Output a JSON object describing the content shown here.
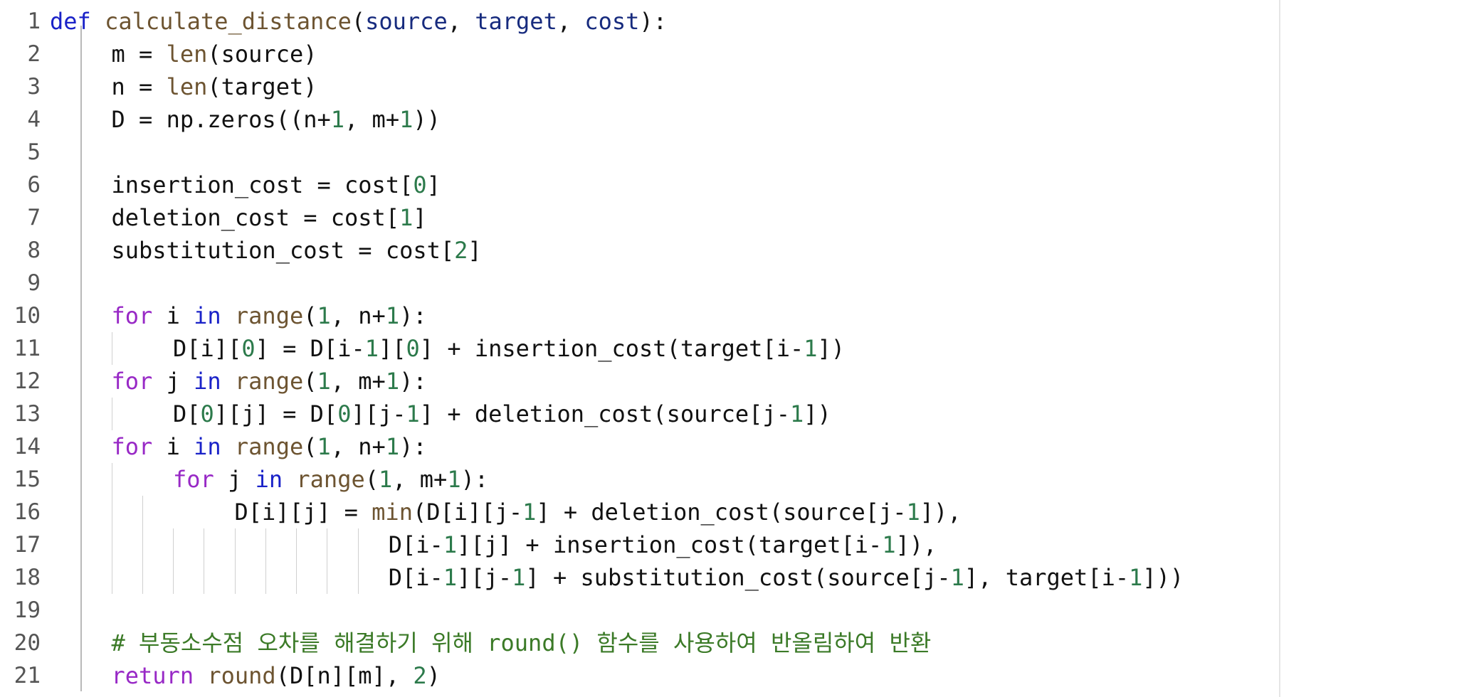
{
  "editor": {
    "language": "python",
    "colors": {
      "background": "#ffffff",
      "line_number": "#555555",
      "def_keyword": "#1a22c8",
      "function_name": "#6d5431",
      "parameter": "#172b7e",
      "control_keyword": "#9829c6",
      "operator_keyword": "#1a22c8",
      "number": "#2c7a4b",
      "builtin": "#6d5431",
      "comment": "#3b7a27",
      "text": "#111111"
    },
    "lines": [
      {
        "n": "1",
        "indent": 0,
        "tokens": [
          [
            "def",
            "def"
          ],
          [
            "plain",
            " "
          ],
          [
            "fn",
            "calculate_distance"
          ],
          [
            "plain",
            "("
          ],
          [
            "param",
            "source"
          ],
          [
            "plain",
            ", "
          ],
          [
            "param",
            "target"
          ],
          [
            "plain",
            ", "
          ],
          [
            "param",
            "cost"
          ],
          [
            "plain",
            "):"
          ]
        ]
      },
      {
        "n": "2",
        "indent": 1,
        "tokens": [
          [
            "plain",
            "m = "
          ],
          [
            "builtin",
            "len"
          ],
          [
            "plain",
            "(source)"
          ]
        ]
      },
      {
        "n": "3",
        "indent": 1,
        "tokens": [
          [
            "plain",
            "n = "
          ],
          [
            "builtin",
            "len"
          ],
          [
            "plain",
            "(target)"
          ]
        ]
      },
      {
        "n": "4",
        "indent": 1,
        "tokens": [
          [
            "plain",
            "D = np.zeros((n+"
          ],
          [
            "num",
            "1"
          ],
          [
            "plain",
            ", m+"
          ],
          [
            "num",
            "1"
          ],
          [
            "plain",
            "))"
          ]
        ]
      },
      {
        "n": "5",
        "indent": 0,
        "tokens": []
      },
      {
        "n": "6",
        "indent": 1,
        "tokens": [
          [
            "plain",
            "insertion_cost = cost["
          ],
          [
            "num",
            "0"
          ],
          [
            "plain",
            "]"
          ]
        ]
      },
      {
        "n": "7",
        "indent": 1,
        "tokens": [
          [
            "plain",
            "deletion_cost = cost["
          ],
          [
            "num",
            "1"
          ],
          [
            "plain",
            "]"
          ]
        ]
      },
      {
        "n": "8",
        "indent": 1,
        "tokens": [
          [
            "plain",
            "substitution_cost = cost["
          ],
          [
            "num",
            "2"
          ],
          [
            "plain",
            "]"
          ]
        ]
      },
      {
        "n": "9",
        "indent": 0,
        "tokens": []
      },
      {
        "n": "10",
        "indent": 1,
        "tokens": [
          [
            "kw",
            "for"
          ],
          [
            "plain",
            " i "
          ],
          [
            "op",
            "in"
          ],
          [
            "plain",
            " "
          ],
          [
            "builtin",
            "range"
          ],
          [
            "plain",
            "("
          ],
          [
            "num",
            "1"
          ],
          [
            "plain",
            ", n+"
          ],
          [
            "num",
            "1"
          ],
          [
            "plain",
            "):"
          ]
        ]
      },
      {
        "n": "11",
        "indent": 2,
        "tokens": [
          [
            "plain",
            "D[i]["
          ],
          [
            "num",
            "0"
          ],
          [
            "plain",
            "] = D[i-"
          ],
          [
            "num",
            "1"
          ],
          [
            "plain",
            "]["
          ],
          [
            "num",
            "0"
          ],
          [
            "plain",
            "] + insertion_cost(target[i-"
          ],
          [
            "num",
            "1"
          ],
          [
            "plain",
            "])"
          ]
        ]
      },
      {
        "n": "12",
        "indent": 1,
        "tokens": [
          [
            "kw",
            "for"
          ],
          [
            "plain",
            " j "
          ],
          [
            "op",
            "in"
          ],
          [
            "plain",
            " "
          ],
          [
            "builtin",
            "range"
          ],
          [
            "plain",
            "("
          ],
          [
            "num",
            "1"
          ],
          [
            "plain",
            ", m+"
          ],
          [
            "num",
            "1"
          ],
          [
            "plain",
            "):"
          ]
        ]
      },
      {
        "n": "13",
        "indent": 2,
        "tokens": [
          [
            "plain",
            "D["
          ],
          [
            "num",
            "0"
          ],
          [
            "plain",
            "][j] = D["
          ],
          [
            "num",
            "0"
          ],
          [
            "plain",
            "][j-"
          ],
          [
            "num",
            "1"
          ],
          [
            "plain",
            "] + deletion_cost(source[j-"
          ],
          [
            "num",
            "1"
          ],
          [
            "plain",
            "])"
          ]
        ]
      },
      {
        "n": "14",
        "indent": 1,
        "tokens": [
          [
            "kw",
            "for"
          ],
          [
            "plain",
            " i "
          ],
          [
            "op",
            "in"
          ],
          [
            "plain",
            " "
          ],
          [
            "builtin",
            "range"
          ],
          [
            "plain",
            "("
          ],
          [
            "num",
            "1"
          ],
          [
            "plain",
            ", n+"
          ],
          [
            "num",
            "1"
          ],
          [
            "plain",
            "):"
          ]
        ]
      },
      {
        "n": "15",
        "indent": 2,
        "tokens": [
          [
            "kw",
            "for"
          ],
          [
            "plain",
            " j "
          ],
          [
            "op",
            "in"
          ],
          [
            "plain",
            " "
          ],
          [
            "builtin",
            "range"
          ],
          [
            "plain",
            "("
          ],
          [
            "num",
            "1"
          ],
          [
            "plain",
            ", m+"
          ],
          [
            "num",
            "1"
          ],
          [
            "plain",
            "):"
          ]
        ]
      },
      {
        "n": "16",
        "indent": 3,
        "tokens": [
          [
            "plain",
            "D[i][j] = "
          ],
          [
            "builtin",
            "min"
          ],
          [
            "plain",
            "(D[i][j-"
          ],
          [
            "num",
            "1"
          ],
          [
            "plain",
            "] + deletion_cost(source[j-"
          ],
          [
            "num",
            "1"
          ],
          [
            "plain",
            "]),"
          ]
        ]
      },
      {
        "n": "17",
        "indent": 10,
        "tokens": [
          [
            "plain",
            "D[i-"
          ],
          [
            "num",
            "1"
          ],
          [
            "plain",
            "][j] + insertion_cost(target[i-"
          ],
          [
            "num",
            "1"
          ],
          [
            "plain",
            "]),"
          ]
        ]
      },
      {
        "n": "18",
        "indent": 10,
        "tokens": [
          [
            "plain",
            "D[i-"
          ],
          [
            "num",
            "1"
          ],
          [
            "plain",
            "][j-"
          ],
          [
            "num",
            "1"
          ],
          [
            "plain",
            "] + substitution_cost(source[j-"
          ],
          [
            "num",
            "1"
          ],
          [
            "plain",
            "], target[i-"
          ],
          [
            "num",
            "1"
          ],
          [
            "plain",
            "]))"
          ]
        ]
      },
      {
        "n": "19",
        "indent": 0,
        "tokens": []
      },
      {
        "n": "20",
        "indent": 1,
        "tokens": [
          [
            "comment",
            "# 부동소수점 오차를 해결하기 위해 round() 함수를 사용하여 반올림하여 반환"
          ]
        ]
      },
      {
        "n": "21",
        "indent": 1,
        "tokens": [
          [
            "kw",
            "return"
          ],
          [
            "plain",
            " "
          ],
          [
            "builtin",
            "round"
          ],
          [
            "plain",
            "(D[n][m], "
          ],
          [
            "num",
            "2"
          ],
          [
            "plain",
            ")"
          ]
        ]
      }
    ]
  }
}
